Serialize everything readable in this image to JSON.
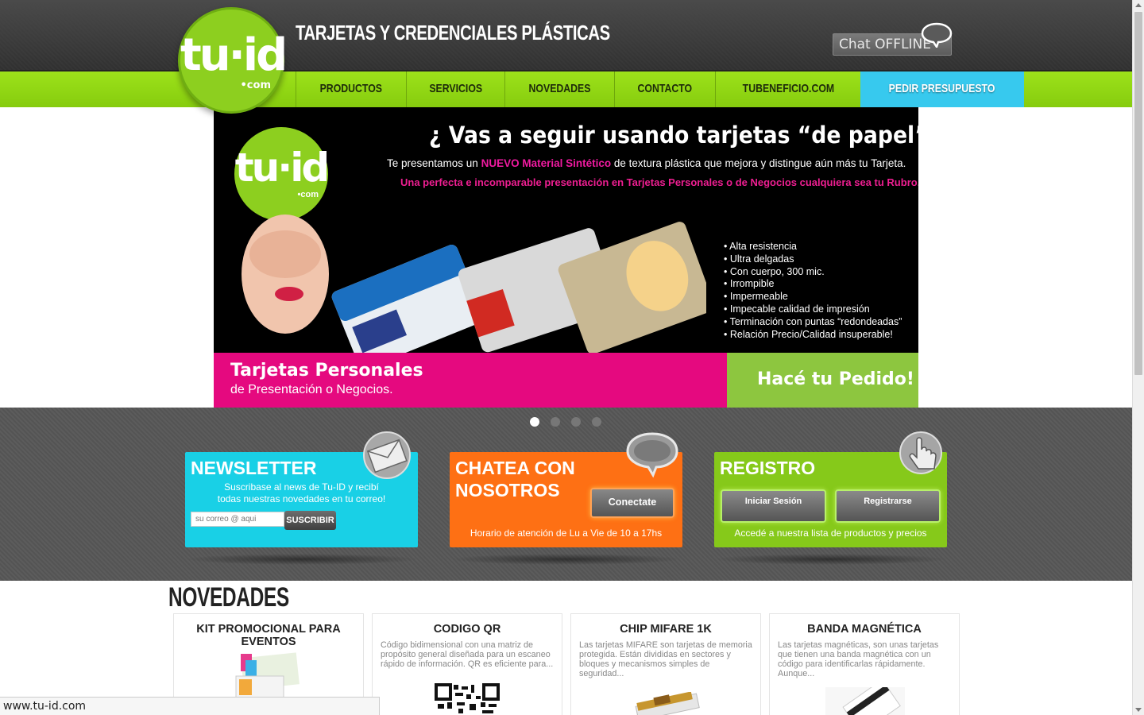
{
  "header": {
    "logo_text": "tu·id",
    "logo_suffix": "•com",
    "site_title": "TARJETAS Y CREDENCIALES PLÁSTICAS",
    "chat_status": "Chat OFFLINE"
  },
  "nav": {
    "items": [
      "PRODUCTOS",
      "SERVICIOS",
      "NOVEDADES",
      "CONTACTO",
      "TUBENEFICIO.COM",
      "PEDIR PRESUPUESTO"
    ]
  },
  "banner": {
    "logo_text": "tu·id",
    "logo_suffix": "•com",
    "headline": "¿ Vas a seguir usando tarjetas “de papel” ?",
    "sub1_pre": "Te presentamos un ",
    "sub1_highlight": "NUEVO Material Sintético",
    "sub1_post": " de textura plástica que mejora y distingue aún más tu Tarjeta.",
    "sub2": "Una perfecta e incomparable presentación en Tarjetas Personales o de Negocios cualquiera sea tu Rubro.",
    "bullets": [
      "Alta resistencia",
      "Ultra delgadas",
      "Con cuerpo, 300 mic.",
      "Irrompible",
      "Impermeable",
      "Impecable calidad de impresión",
      "Terminación con puntas “redondeadas”",
      "Relación Precio/Calidad insuperable!"
    ],
    "pink_line1": "Tarjetas Personales",
    "pink_line2": "de Presentación o Negocios.",
    "green_cta": "Hacé tu Pedido!",
    "slide_count": 4,
    "active_slide": 1
  },
  "boxes": {
    "newsletter": {
      "title": "NEWSLETTER",
      "desc_line1": "Suscribase al news de Tu-ID y recibí",
      "desc_line2": "todas nuestras novedades en tu correo!",
      "email_placeholder": "su correo @ aqui",
      "subscribe_label": "SUSCRIBIR"
    },
    "chat": {
      "title": "CHATEA CON NOSOTROS",
      "button_label": "Conectate",
      "hours": "Horario de atención de Lu a Vie de 10 a 17hs"
    },
    "registro": {
      "title": "REGISTRO",
      "login_label": "Iniciar Sesión",
      "register_label": "Registrarse",
      "note": "Accedé a nuestra lista de productos y precios"
    }
  },
  "novedades": {
    "title": "NOVEDADES",
    "cards": [
      {
        "title": "KIT PROMOCIONAL PARA EVENTOS",
        "desc": ""
      },
      {
        "title": "CODIGO QR",
        "desc": "Código bidimensional con una matriz de propósito general diseñada para un escaneo rápido de información. QR es eficiente para..."
      },
      {
        "title": "CHIP MIFARE 1K",
        "desc": "Las tarjetas MIFARE son tarjetas de memoria protegida. Están divididas en sectores y bloques y mecanismos simples de seguridad..."
      },
      {
        "title": "BANDA MAGNÉTICA",
        "desc": "Las tarjetas magnéticas, son unas tarjetas que tienen una banda magnética con un código para identificarlas rápidamente. Aunque..."
      }
    ]
  },
  "status_bar": "www.tu-id.com",
  "colors": {
    "brand_green": "#8dcf1f",
    "nav_green": "#94d914",
    "highlight_cyan": "#37c9ee",
    "newsletter_cyan": "#19d0e6",
    "chat_orange": "#fe7014",
    "registro_green": "#86c91a",
    "banner_pink": "#e5097f"
  }
}
